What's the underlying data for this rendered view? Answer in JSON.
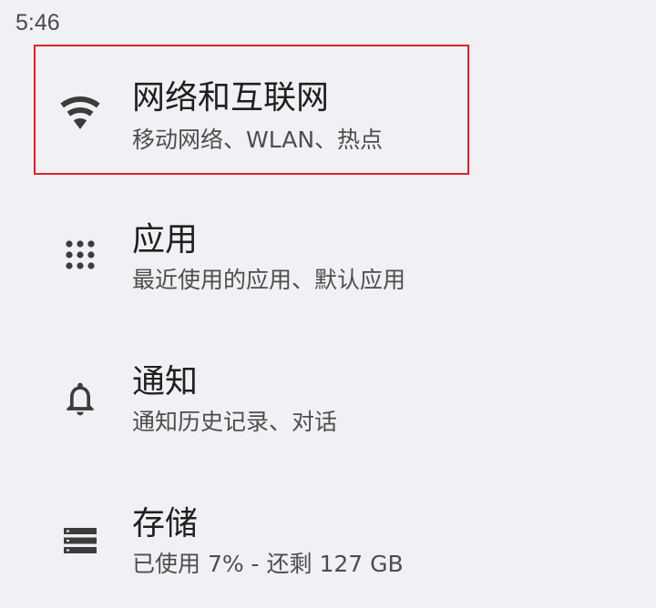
{
  "status_bar": {
    "time": "5:46"
  },
  "settings": {
    "items": [
      {
        "icon": "wifi-icon",
        "title": "网络和互联网",
        "subtitle": "移动网络、WLAN、热点"
      },
      {
        "icon": "apps-grid-icon",
        "title": "应用",
        "subtitle": "最近使用的应用、默认应用"
      },
      {
        "icon": "bell-icon",
        "title": "通知",
        "subtitle": "通知历史记录、对话"
      },
      {
        "icon": "storage-icon",
        "title": "存储",
        "subtitle": "已使用 7% - 还剩 127 GB"
      }
    ]
  },
  "highlight": {
    "color": "#d9242f"
  }
}
